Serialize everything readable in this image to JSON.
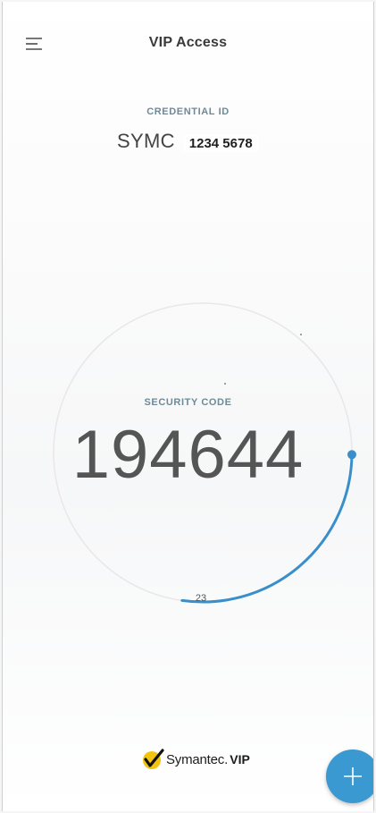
{
  "header": {
    "title": "VIP Access",
    "menu_icon": "hamburger-menu-icon"
  },
  "credential": {
    "label": "CREDENTIAL ID",
    "prefix": "SYMC",
    "number": "1234 5678"
  },
  "security_code": {
    "label": "SECURITY CODE",
    "value": "194644",
    "seconds_remaining": "23",
    "timer_fraction_remaining": 0.27
  },
  "branding": {
    "logo_icon": "checkmark-logo-icon",
    "name": "Symantec",
    "dot": ".",
    "product": "VIP"
  },
  "fab": {
    "icon": "plus-icon"
  },
  "colors": {
    "accent": "#3a99d0",
    "label": "#6e8a98",
    "logo_yellow": "#f2c40f"
  }
}
